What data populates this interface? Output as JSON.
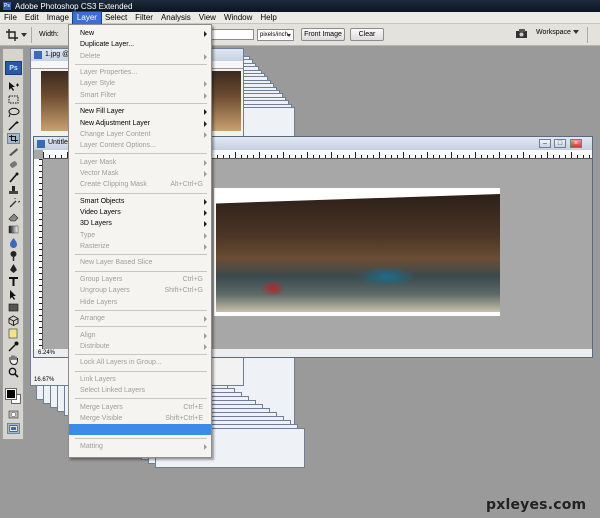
{
  "window": {
    "title": "Adobe Photoshop CS3 Extended",
    "app_badge": "Ps"
  },
  "menubar": [
    "File",
    "Edit",
    "Image",
    "Layer",
    "Select",
    "Filter",
    "Analysis",
    "View",
    "Window",
    "Help"
  ],
  "active_menu": "Layer",
  "options_bar": {
    "width_label": "Width:",
    "units_value": "pixels/inch",
    "front_image_label": "Front Image",
    "clear_label": "Clear",
    "workspace_label": "Workspace"
  },
  "tools": {
    "logo": "Ps"
  },
  "documents": {
    "back": {
      "title": "1.jpg @",
      "zoom": "16.67%"
    },
    "main": {
      "title": "Untitle",
      "zoom": "6.24%"
    }
  },
  "layer_menu": [
    {
      "label": "New",
      "sub": true,
      "enabled": true
    },
    {
      "label": "Duplicate Layer...",
      "enabled": true
    },
    {
      "label": "Delete",
      "sub": true,
      "enabled": false
    },
    {
      "sep": true
    },
    {
      "label": "Layer Properties...",
      "enabled": false
    },
    {
      "label": "Layer Style",
      "sub": true,
      "enabled": false
    },
    {
      "label": "Smart Filter",
      "sub": true,
      "enabled": false
    },
    {
      "sep": true
    },
    {
      "label": "New Fill Layer",
      "sub": true,
      "enabled": true
    },
    {
      "label": "New Adjustment Layer",
      "sub": true,
      "enabled": true
    },
    {
      "label": "Change Layer Content",
      "sub": true,
      "enabled": false
    },
    {
      "label": "Layer Content Options...",
      "enabled": false
    },
    {
      "sep": true
    },
    {
      "label": "Layer Mask",
      "sub": true,
      "enabled": false
    },
    {
      "label": "Vector Mask",
      "sub": true,
      "enabled": false
    },
    {
      "label": "Create Clipping Mask",
      "shortcut": "Alt+Ctrl+G",
      "enabled": false
    },
    {
      "sep": true
    },
    {
      "label": "Smart Objects",
      "sub": true,
      "enabled": true
    },
    {
      "label": "Video Layers",
      "sub": true,
      "enabled": true
    },
    {
      "label": "3D Layers",
      "sub": true,
      "enabled": true
    },
    {
      "label": "Type",
      "sub": true,
      "enabled": false
    },
    {
      "label": "Rasterize",
      "sub": true,
      "enabled": false
    },
    {
      "sep": true
    },
    {
      "label": "New Layer Based Slice",
      "enabled": false
    },
    {
      "sep": true
    },
    {
      "label": "Group Layers",
      "shortcut": "Ctrl+G",
      "enabled": false
    },
    {
      "label": "Ungroup Layers",
      "shortcut": "Shift+Ctrl+G",
      "enabled": false
    },
    {
      "label": "Hide Layers",
      "enabled": false
    },
    {
      "sep": true
    },
    {
      "label": "Arrange",
      "sub": true,
      "enabled": false
    },
    {
      "sep": true
    },
    {
      "label": "Align",
      "sub": true,
      "enabled": false
    },
    {
      "label": "Distribute",
      "sub": true,
      "enabled": false
    },
    {
      "sep": true
    },
    {
      "label": "Lock All Layers in Group...",
      "enabled": false
    },
    {
      "sep": true
    },
    {
      "label": "Link Layers",
      "enabled": false
    },
    {
      "label": "Select Linked Layers",
      "enabled": false
    },
    {
      "sep": true
    },
    {
      "label": "Merge Layers",
      "shortcut": "Ctrl+E",
      "enabled": false
    },
    {
      "label": "Merge Visible",
      "shortcut": "Shift+Ctrl+E",
      "enabled": false
    },
    {
      "label": "",
      "highlighted": true,
      "enabled": true
    },
    {
      "sep": true
    },
    {
      "label": "Matting",
      "sub": true,
      "enabled": false
    }
  ],
  "watermark": "pxleyes.com"
}
